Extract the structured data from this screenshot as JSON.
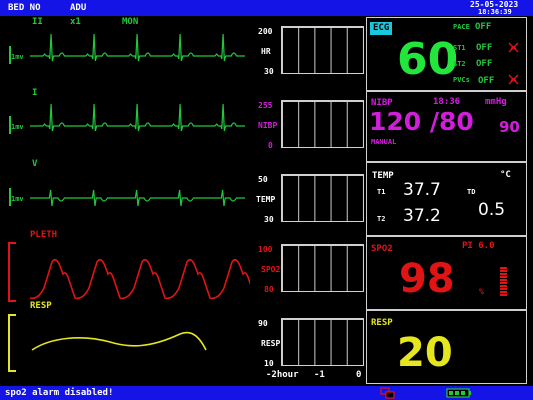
{
  "header": {
    "bed": "BED NO",
    "patient_type": "ADU",
    "date": "25-05-2023",
    "time": "18:36:39"
  },
  "ecg_leads": [
    {
      "lead": "II",
      "gain": "x1",
      "mode": "MON",
      "scale": "1mv"
    },
    {
      "lead": "I",
      "scale": "1mv"
    },
    {
      "lead": "V",
      "scale": "1mv"
    }
  ],
  "waves": {
    "pleth": "PLETH",
    "resp": "RESP"
  },
  "trends": [
    {
      "top": "200",
      "label": "HR",
      "bottom": "30"
    },
    {
      "top": "255",
      "label": "NIBP",
      "bottom": "0"
    },
    {
      "top": "50",
      "label": "TEMP",
      "bottom": "30"
    },
    {
      "top": "100",
      "label": "SPO2",
      "bottom": "80"
    },
    {
      "top": "90",
      "label": "RESP",
      "bottom": "10"
    }
  ],
  "trend_axis": {
    "start": "-2hour",
    "mid": "-1",
    "end": "0"
  },
  "ecg": {
    "tag": "ECG",
    "hr": "60",
    "pace_label": "PACE",
    "pace": "OFF",
    "st1_label": "ST1",
    "st1": "OFF",
    "st2_label": "ST2",
    "st2": "OFF",
    "pvcs_label": "PVCs",
    "pvcs": "OFF"
  },
  "nibp": {
    "title": "NIBP",
    "time": "18:36",
    "unit": "mmHg",
    "value": "120 /80",
    "mean": "90",
    "mode": "MANUAL"
  },
  "temp": {
    "title": "TEMP",
    "unit": "°C",
    "t1_label": "T1",
    "t1": "37.7",
    "t2_label": "T2",
    "t2": "37.2",
    "td_label": "TD",
    "td": "0.5"
  },
  "spo2": {
    "title": "SPO2",
    "pi": "PI 6.0",
    "value": "98",
    "unit": "%"
  },
  "resp": {
    "title": "RESP",
    "value": "20"
  },
  "status": {
    "message": "spo2 alarm disabled!"
  },
  "colors": {
    "ecg": "#22c83c",
    "pleth": "#e01414",
    "resp": "#e6e61e",
    "nibp": "#d21edc",
    "bar": "#1414e6"
  }
}
